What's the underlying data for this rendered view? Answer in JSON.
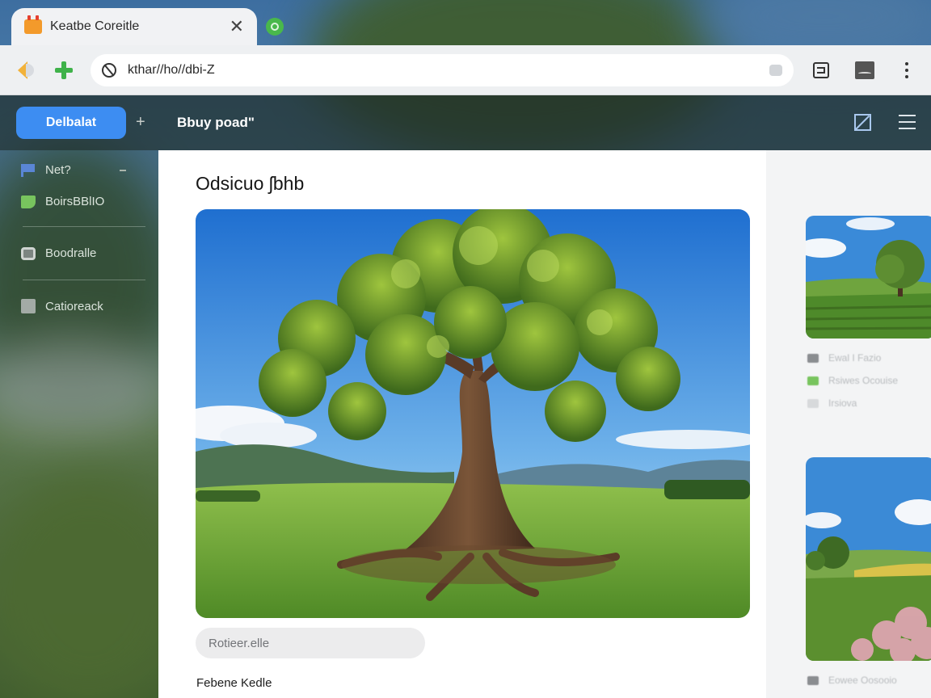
{
  "browser": {
    "tab_title": "Keatbe Coreitle",
    "url": "kthar//ho//dbi-Z"
  },
  "header": {
    "primary_button": "Delbalat",
    "title": "Bbuy poad\""
  },
  "sidebar": {
    "items": [
      {
        "label": "Net?",
        "icon": "flag-icon"
      },
      {
        "label": "BoirsBBlIO",
        "icon": "tag-icon"
      },
      {
        "label": "Boodralle",
        "icon": "record-icon"
      },
      {
        "label": "Catioreack",
        "icon": "box-icon"
      }
    ]
  },
  "main": {
    "title": "Odsicuo ʃbhb",
    "input_placeholder": "Rotieer.elle",
    "footer_label": "Febene Kedle"
  },
  "right_rail": {
    "rows": [
      {
        "text": "Ewal I Fazio",
        "color": "#8a8d90"
      },
      {
        "text": "Rsiwes Ocouise",
        "color": "#78c45e"
      },
      {
        "text": "Irsiova",
        "color": "#d7d9db"
      },
      {
        "text": "Eowee Oosooio",
        "color": "#8a8d90"
      }
    ]
  },
  "colors": {
    "accent": "#3d8df2",
    "tab_favicon": "#f39a2b",
    "new_tab": "#49b84b",
    "add": "#3fb24a"
  }
}
